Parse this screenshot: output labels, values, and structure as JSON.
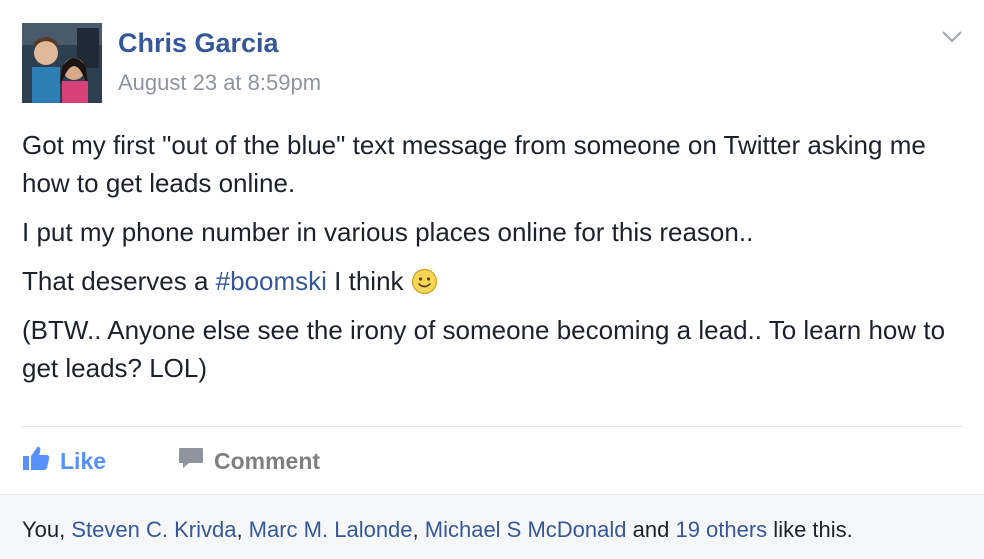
{
  "post": {
    "author": "Chris Garcia",
    "timestamp": "August 23 at 8:59pm",
    "paragraphs": {
      "p1": "Got my first \"out of the blue\" text message from someone on Twitter asking me how to get leads online.",
      "p2": "I put my phone number in various places online for this reason..",
      "p3_before": "That deserves a ",
      "p3_hashtag": "#boomski",
      "p3_after": " I think ",
      "p4": "(BTW.. Anyone else see the irony of someone becoming a lead.. To learn how to get leads? LOL)"
    }
  },
  "actions": {
    "like_label": "Like",
    "comment_label": "Comment"
  },
  "likes": {
    "you": "You",
    "sep1": ", ",
    "person1": "Steven C. Krivda",
    "sep2": ", ",
    "person2": "Marc M. Lalonde",
    "sep3": ", ",
    "person3": "Michael S McDonald",
    "and": " and ",
    "others": "19 others",
    "suffix": " like this."
  },
  "icons": {
    "menu": "chevron-down-icon",
    "emoji": "smiley-icon",
    "like": "thumbs-up-icon",
    "comment": "speech-bubble-icon"
  },
  "colors": {
    "link": "#365899",
    "like_accent": "#5890ff",
    "meta_gray": "#90949c",
    "action_gray": "#7f7f7f"
  }
}
